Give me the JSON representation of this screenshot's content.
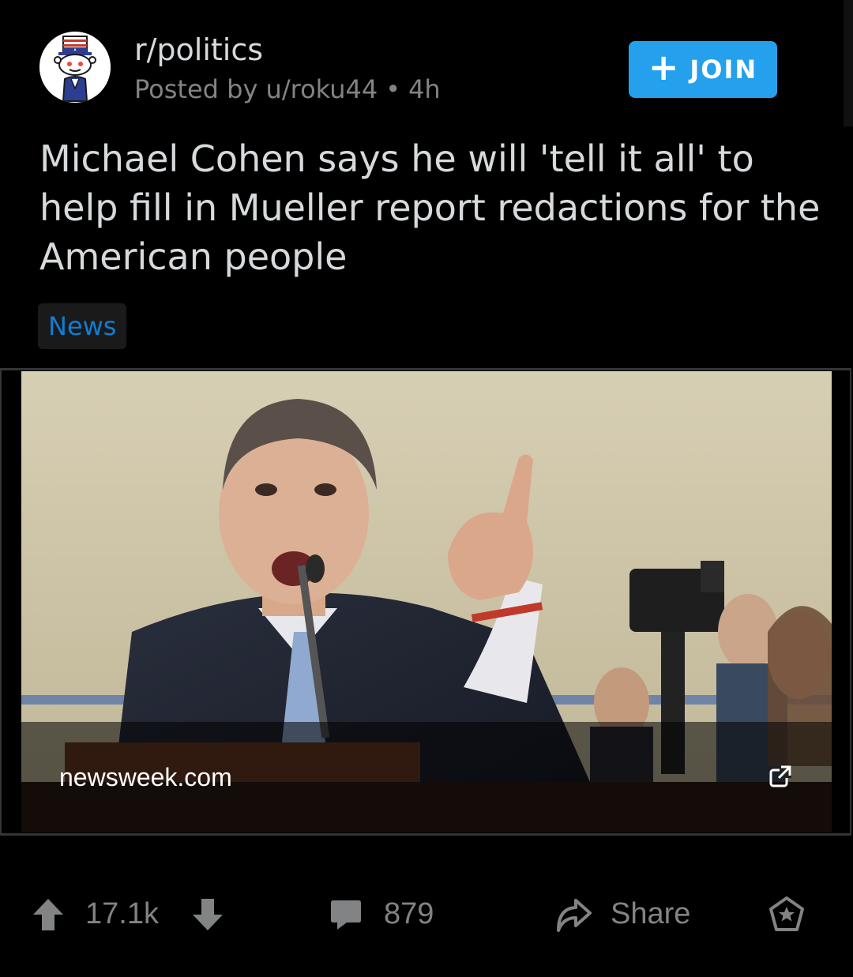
{
  "header": {
    "subreddit": "r/politics",
    "posted_by": "Posted by u/roku44",
    "separator": "•",
    "age": "4h",
    "join_label": "JOIN",
    "join_icon": "plus-icon",
    "avatar_icon": "uncle-sam-snoo-icon"
  },
  "post": {
    "title": "Michael Cohen says he will 'tell it all' to help fill in Mueller report redactions for the American people",
    "flair": "News"
  },
  "link_preview": {
    "domain": "newsweek.com",
    "thumbnail_icon": "news-photo-thumbnail",
    "external_icon": "external-link-icon"
  },
  "actions": {
    "score": "17.1k",
    "comments": "879",
    "share_label": "Share",
    "upvote_icon": "upvote-arrow-icon",
    "downvote_icon": "downvote-arrow-icon",
    "comment_icon": "comment-bubble-icon",
    "share_icon": "share-arrow-icon",
    "award_icon": "award-star-icon"
  },
  "colors": {
    "background": "#000000",
    "join_button": "#24a0ed",
    "flair_text": "#0f7ed1",
    "muted": "#818384"
  }
}
